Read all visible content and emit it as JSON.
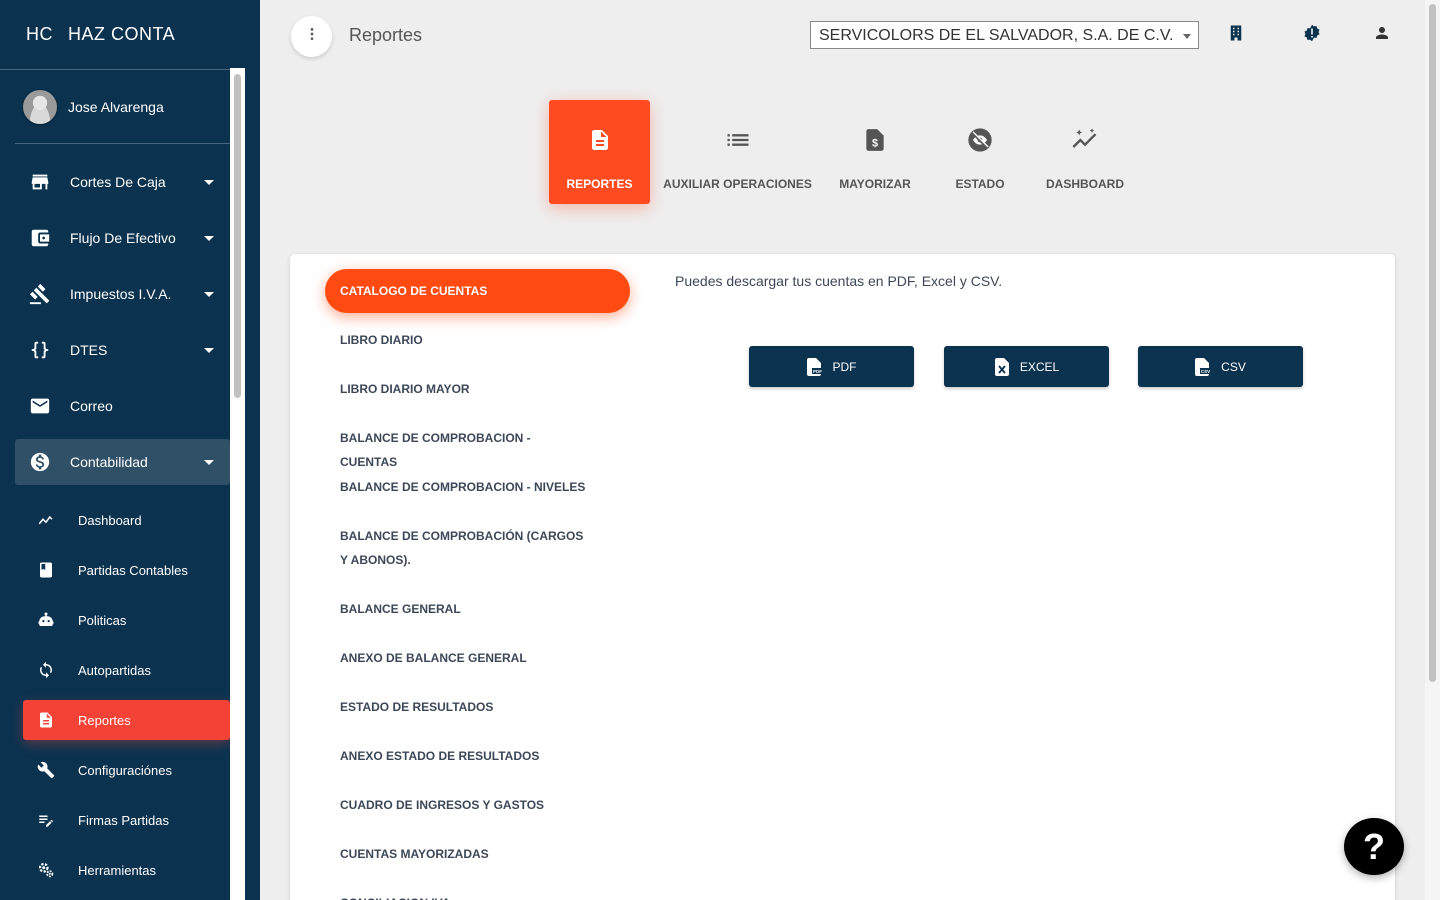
{
  "sidebar": {
    "brand_mini": "HC",
    "brand_full": "HAZ CONTA",
    "user_name": "Jose Alvarenga",
    "items": [
      {
        "label": "Cortes De Caja",
        "icon": "store-icon"
      },
      {
        "label": "Flujo De Efectivo",
        "icon": "wallet-icon"
      },
      {
        "label": "Impuestos I.V.A.",
        "icon": "gavel-icon"
      },
      {
        "label": "DTES",
        "icon": "code-braces-icon"
      },
      {
        "label": "Correo",
        "icon": "mail-icon"
      },
      {
        "label": "Contabilidad",
        "icon": "dollar-circle-icon"
      }
    ],
    "subitems": [
      {
        "label": "Dashboard",
        "icon": "trend-icon"
      },
      {
        "label": "Partidas Contables",
        "icon": "book-icon"
      },
      {
        "label": "Politicas",
        "icon": "robot-icon"
      },
      {
        "label": "Autopartidas",
        "icon": "sync-icon"
      },
      {
        "label": "Reportes",
        "icon": "document-icon"
      },
      {
        "label": "Configuraciónes",
        "icon": "wrench-icon"
      },
      {
        "label": "Firmas Partidas",
        "icon": "edit-list-icon"
      },
      {
        "label": "Herramientas",
        "icon": "gears-icon"
      }
    ]
  },
  "header": {
    "title": "Reportes",
    "company": "SERVICOLORS DE EL SALVADOR, S.A. DE C.V."
  },
  "tabs": [
    {
      "label": "REPORTES",
      "icon": "document-icon"
    },
    {
      "label": "AUXILIAR OPERACIONES",
      "icon": "list-icon"
    },
    {
      "label": "MAYORIZAR",
      "icon": "dollar-file-icon"
    },
    {
      "label": "ESTADO",
      "icon": "visibility-off-icon"
    },
    {
      "label": "DASHBOARD",
      "icon": "sparkle-trend-icon"
    }
  ],
  "reports": {
    "selected": "CATALOGO DE CUENTAS",
    "items": [
      "LIBRO DIARIO",
      "LIBRO DIARIO MAYOR",
      "BALANCE DE COMPROBACION - CUENTAS",
      "BALANCE DE COMPROBACION - NIVELES",
      "BALANCE DE COMPROBACIÓN (CARGOS Y ABONOS).",
      "BALANCE GENERAL",
      "ANEXO DE BALANCE GENERAL",
      "ESTADO DE RESULTADOS",
      "ANEXO ESTADO DE RESULTADOS",
      "CUADRO DE INGRESOS Y GASTOS",
      "CUENTAS MAYORIZADAS",
      "CONCILIACION IVA"
    ]
  },
  "download": {
    "description": "Puedes descargar tus cuentas en PDF, Excel y CSV.",
    "pdf_label": "PDF",
    "excel_label": "EXCEL",
    "csv_label": "CSV",
    "pdf_tag": "PDF",
    "csv_tag": "CSV"
  },
  "help": {
    "label": "?"
  },
  "colors": {
    "sidebar_bg": "#0b3350",
    "accent": "#ff4b1f",
    "active_sub": "#f44336",
    "button_bg": "#0b3350"
  }
}
